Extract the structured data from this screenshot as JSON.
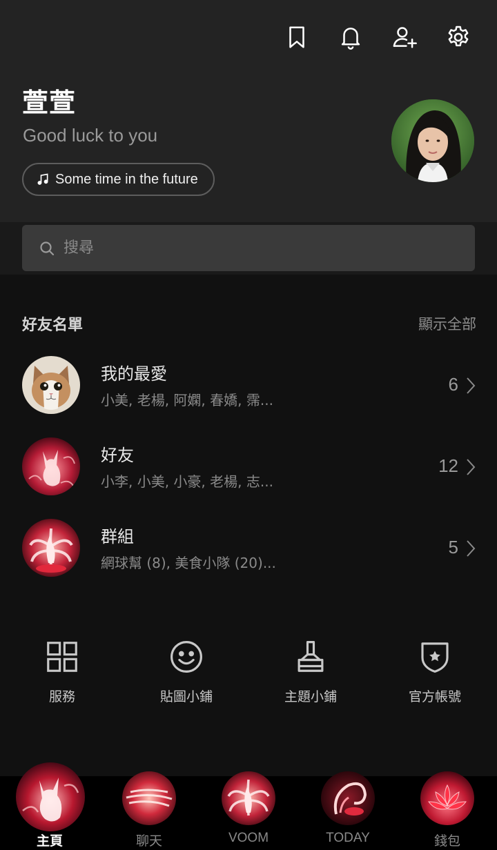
{
  "header": {
    "icons": [
      "bookmark-icon",
      "bell-icon",
      "add-friend-icon",
      "gear-icon"
    ],
    "name": "萱萱",
    "status_message": "Good luck to you",
    "music": "Some time in the future"
  },
  "search": {
    "placeholder": "搜尋"
  },
  "friends_section": {
    "title": "好友名單",
    "show_all": "顯示全部",
    "rows": [
      {
        "title": "我的最愛",
        "subtitle": "小美, 老楊, 阿嫻, 春嬌, 霈...",
        "count": "6"
      },
      {
        "title": "好友",
        "subtitle": "小李, 小美, 小豪, 老楊, 志...",
        "count": "12"
      },
      {
        "title": "群組",
        "subtitle": "網球幫 (8), 美食小隊 (20)...",
        "count": "5"
      }
    ]
  },
  "services": [
    {
      "label": "服務",
      "icon": "grid-icon"
    },
    {
      "label": "貼圖小鋪",
      "icon": "smiley-icon"
    },
    {
      "label": "主題小鋪",
      "icon": "brush-icon"
    },
    {
      "label": "官方帳號",
      "icon": "shield-star-icon"
    }
  ],
  "tabs": [
    {
      "label": "主頁",
      "active": true
    },
    {
      "label": "聊天",
      "active": false
    },
    {
      "label": "VOOM",
      "active": false
    },
    {
      "label": "TODAY",
      "active": false
    },
    {
      "label": "錢包",
      "active": false
    }
  ],
  "colors": {
    "background": "#111111",
    "header": "#232323",
    "accent_red": "#e0304a"
  }
}
